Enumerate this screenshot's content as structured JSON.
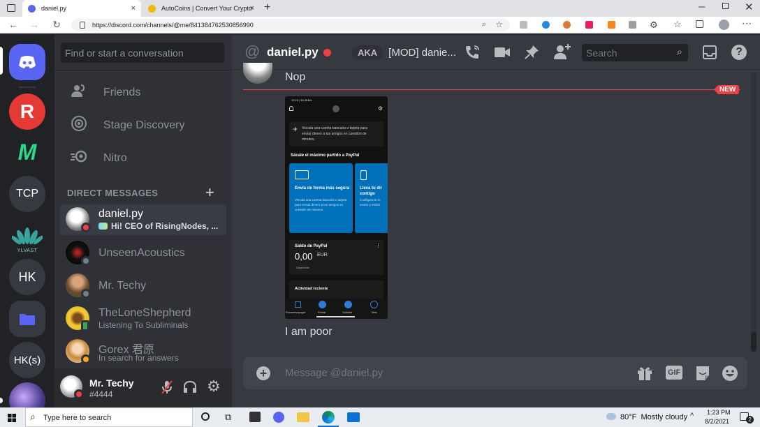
{
  "browser": {
    "tabs": [
      {
        "label": "daniel.py",
        "close": "×"
      },
      {
        "label": "AutoCoins | Convert Your Crypto...",
        "close": "×"
      }
    ],
    "new_tab": "+",
    "url": "https://discord.com/channels/@me/841384762530856990"
  },
  "guilds": [
    "TCP",
    "HK",
    "HK(s)"
  ],
  "guild_tag": "YLVAST",
  "dm_column": {
    "search_placeholder": "Find or start a conversation",
    "nav": [
      "Friends",
      "Stage Discovery",
      "Nitro"
    ],
    "dm_header": "DIRECT MESSAGES",
    "dms": [
      {
        "name": "daniel.py",
        "sub": "Hi! CEO of RisingNodes, ...",
        "selected": true
      },
      {
        "name": "UnseenAcoustics",
        "sub": ""
      },
      {
        "name": "Mr. Techy",
        "sub": ""
      },
      {
        "name": "TheLoneShepherd",
        "sub": "Listening To Subliminals"
      },
      {
        "name": "Gorex 君原",
        "sub": "In search for answers"
      }
    ],
    "user": {
      "name": "Mr. Techy",
      "tag": "#4444"
    }
  },
  "header": {
    "channel": "daniel.py",
    "aka": "AKA",
    "aka_name": "[MOD] danie...",
    "search": "Search"
  },
  "messages": {
    "first": "Nop",
    "new_badge": "NEW",
    "second": "I am poor"
  },
  "phone": {
    "status": "19:23 | 46,3KB/s",
    "link_text": "Vincula una cuenta bancaria o tarjeta para enviar dinero a tus amigos en cuestión de minutos.",
    "section": "Sácale el máximo partido a PayPal",
    "card1_title": "Envía de forma más segura",
    "card1_body": "Vincula una cuenta bancaria o tarjeta para enviar dinero a tus amigos en cuestión de minutos.",
    "card2_title": "Lleva tu dir contigo",
    "card2_body": "Configura tu m enviar y recibir",
    "balance_title": "Saldo de PayPal",
    "balance_amount": "0,00",
    "balance_currency": "EUR",
    "balance_label": "Disponible",
    "recent": "Actividad reciente",
    "tabs": [
      "Escanear/pagar",
      "Enviar",
      "Solicitar",
      "Más"
    ]
  },
  "composer": {
    "placeholder": "Message @daniel.py",
    "gif": "GIF"
  },
  "taskbar": {
    "search": "Type here to search",
    "weather": "80°F  Mostly cloudy",
    "time": "1:23 PM",
    "date": "8/2/2021",
    "notif": "2"
  },
  "colors": {
    "accent": "#5865f2",
    "dnd": "#ed4245",
    "online": "#3ba55d",
    "new": "#ed4245"
  }
}
